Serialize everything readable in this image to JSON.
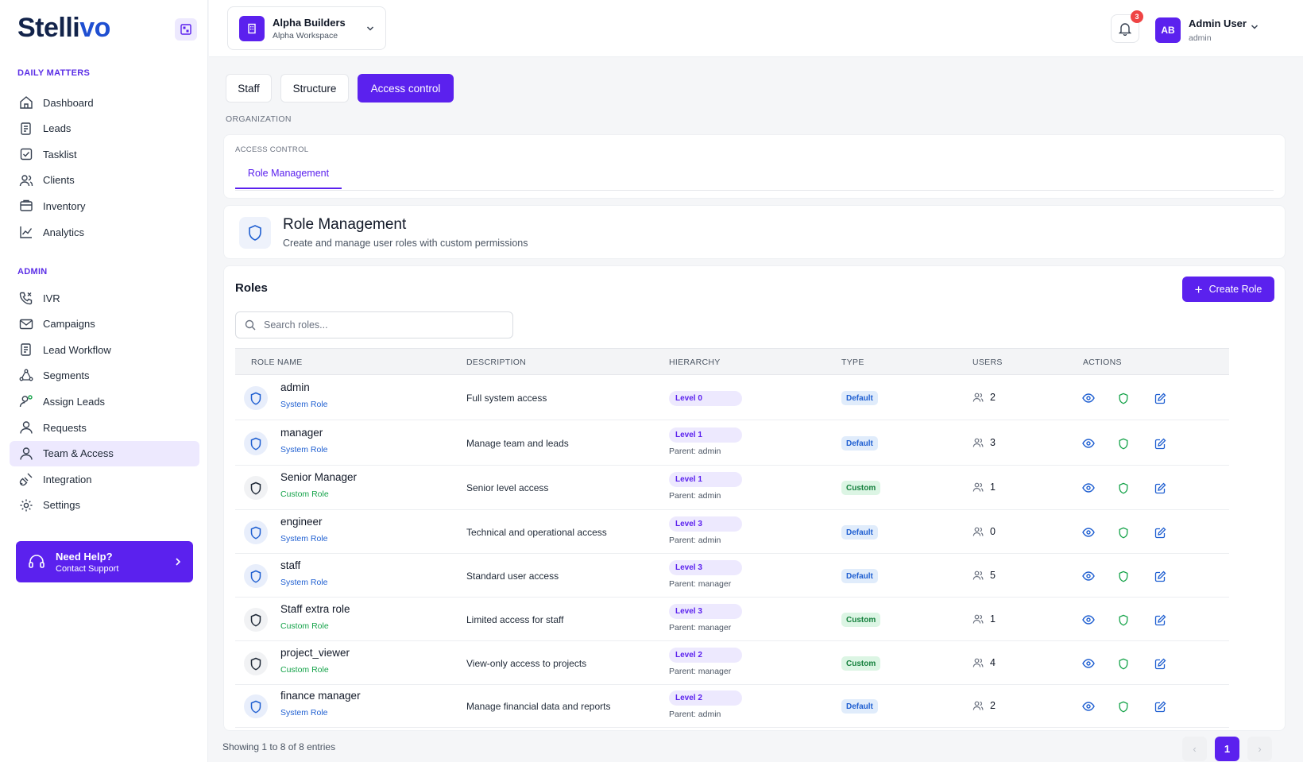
{
  "brand": {
    "name_prefix": "Stelli",
    "name_suffix": "vo"
  },
  "sidebar": {
    "section_daily": "DAILY MATTERS",
    "section_admin": "ADMIN",
    "daily_items": [
      {
        "label": "Dashboard",
        "icon": "home-icon"
      },
      {
        "label": "Leads",
        "icon": "file-list-icon"
      },
      {
        "label": "Tasklist",
        "icon": "checkbox-icon"
      },
      {
        "label": "Clients",
        "icon": "users-icon"
      },
      {
        "label": "Inventory",
        "icon": "inventory-icon"
      },
      {
        "label": "Analytics",
        "icon": "chart-line-icon"
      }
    ],
    "admin_items": [
      {
        "label": "IVR",
        "icon": "phone-icon"
      },
      {
        "label": "Campaigns",
        "icon": "mail-icon"
      },
      {
        "label": "Lead Workflow",
        "icon": "workflow-icon"
      },
      {
        "label": "Segments",
        "icon": "segments-icon"
      },
      {
        "label": "Assign Leads",
        "icon": "user-assign-icon"
      },
      {
        "label": "Requests",
        "icon": "user-icon"
      },
      {
        "label": "Team & Access",
        "icon": "user-icon",
        "active": true
      },
      {
        "label": "Integration",
        "icon": "plug-icon"
      },
      {
        "label": "Settings",
        "icon": "gear-icon"
      }
    ],
    "help": {
      "title": "Need Help?",
      "subtitle": "Contact Support"
    }
  },
  "header": {
    "workspace": {
      "name": "Alpha Builders",
      "sub": "Alpha Workspace"
    },
    "notifications": "3",
    "user": {
      "initials": "AB",
      "name": "Admin User",
      "role": "admin"
    }
  },
  "tabs": [
    {
      "label": "Staff",
      "active": false
    },
    {
      "label": "Structure",
      "active": false
    },
    {
      "label": "Access control",
      "active": true
    }
  ],
  "breadcrumb": "ORGANIZATION",
  "access_control": {
    "label": "ACCESS CONTROL",
    "subtab": "Role Management"
  },
  "role_management": {
    "title": "Role Management",
    "subtitle": "Create and manage user roles with custom permissions"
  },
  "roles_panel": {
    "title": "Roles",
    "create_label": "Create Role",
    "search_placeholder": "Search roles...",
    "columns": [
      "ROLE NAME",
      "DESCRIPTION",
      "HIERARCHY",
      "TYPE",
      "USERS",
      "ACTIONS"
    ],
    "rows": [
      {
        "name": "admin",
        "kind": "System Role",
        "desc": "Full system access",
        "level": "Level 0",
        "parent": "",
        "type": "Default",
        "users": "2"
      },
      {
        "name": "manager",
        "kind": "System Role",
        "desc": "Manage team and leads",
        "level": "Level 1",
        "parent": "Parent: admin",
        "type": "Default",
        "users": "3"
      },
      {
        "name": "Senior Manager",
        "kind": "Custom Role",
        "desc": "Senior level access",
        "level": "Level 1",
        "parent": "Parent: admin",
        "type": "Custom",
        "users": "1"
      },
      {
        "name": "engineer",
        "kind": "System Role",
        "desc": "Technical and operational access",
        "level": "Level 3",
        "parent": "Parent: admin",
        "type": "Default",
        "users": "0"
      },
      {
        "name": "staff",
        "kind": "System Role",
        "desc": "Standard user access",
        "level": "Level 3",
        "parent": "Parent: manager",
        "type": "Default",
        "users": "5"
      },
      {
        "name": "Staff extra role",
        "kind": "Custom Role",
        "desc": "Limited access for staff",
        "level": "Level 3",
        "parent": "Parent: manager",
        "type": "Custom",
        "users": "1"
      },
      {
        "name": "project_viewer",
        "kind": "Custom Role",
        "desc": "View-only access to projects",
        "level": "Level 2",
        "parent": "Parent: manager",
        "type": "Custom",
        "users": "4"
      },
      {
        "name": "finance manager",
        "kind": "System Role",
        "desc": "Manage financial data and reports",
        "level": "Level 2",
        "parent": "Parent: admin",
        "type": "Default",
        "users": "2"
      }
    ]
  },
  "pagination": {
    "summary": "Showing 1 to 8 of 8 entries",
    "current": "1",
    "prev": "‹",
    "next": "›"
  },
  "colors": {
    "primary": "#5b21ee",
    "system_blue": "#1f5fd1",
    "custom_green": "#16a34a"
  }
}
